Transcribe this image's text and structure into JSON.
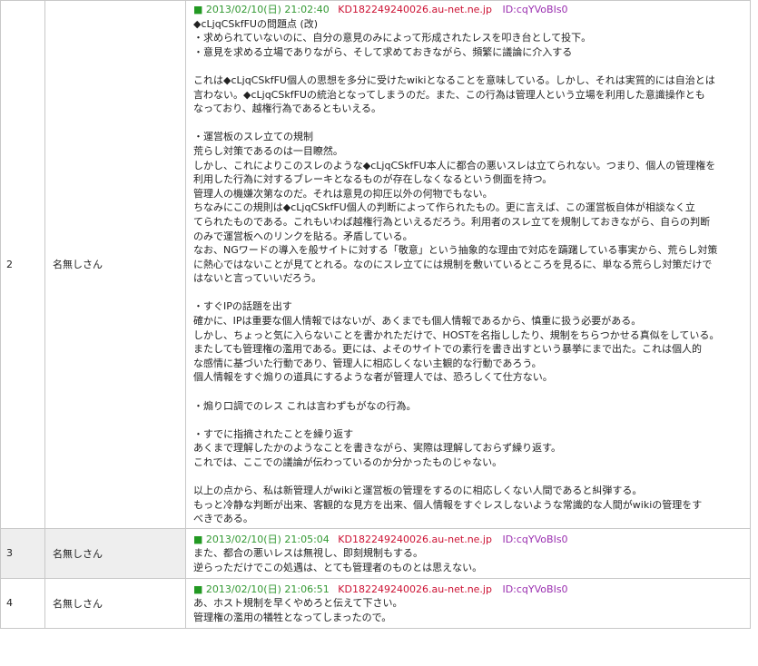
{
  "posts": [
    {
      "number": "2",
      "name": "名無しさん",
      "marker": "■",
      "date": "2013/02/10(日) 21:02:40",
      "host": "KD182249240026.au-net.ne.jp",
      "id": "ID:cqYVoBIs0",
      "lines": [
        "◆cLjqCSkfFUの問題点 (改)",
        "・求められていないのに、自分の意見のみによって形成されたレスを叩き台として投下。",
        "・意見を求める立場でありながら、そして求めておきながら、頻繁に議論に介入する",
        "",
        "これは◆cLjqCSkfFU個人の思想を多分に受けたwikiとなることを意味している。しかし、それは実質的には自治とは",
        "言わない。◆cLjqCSkfFUの統治となってしまうのだ。また、この行為は管理人という立場を利用した意識操作とも",
        "なっており、越権行為であるともいえる。",
        "",
        "・運営板のスレ立ての規制",
        "荒らし対策であるのは一目瞭然。",
        "しかし、これによりこのスレのような◆cLjqCSkfFU本人に都合の悪いスレは立てられない。つまり、個人の管理権を",
        "利用した行為に対するブレーキとなるものが存在しなくなるという側面を持つ。",
        "管理人の機嫌次第なのだ。それは意見の抑圧以外の何物でもない。",
        "ちなみにこの規則は◆cLjqCSkfFU個人の判断によって作られたもの。更に言えば、この運営板自体が相談なく立",
        "てられたものである。これもいわば越権行為といえるだろう。利用者のスレ立てを規制しておきながら、自らの判断",
        "のみで運営板へのリンクを貼る。矛盾している。",
        "なお、NGワードの導入を般サイトに対する「敬意」という抽象的な理由で対応を躊躇している事実から、荒らし対策",
        "に熱心ではないことが見てとれる。なのにスレ立てには規制を敷いているところを見るに、単なる荒らし対策だけで",
        "はないと言っていいだろう。",
        "",
        "・すぐIPの話題を出す",
        "確かに、IPは重要な個人情報ではないが、あくまでも個人情報であるから、慎重に扱う必要がある。",
        "しかし、ちょっと気に入らないことを書かれただけで、HOSTを名指ししたり、規制をちらつかせる真似をしている。",
        "またしても管理権の濫用である。更には、よそのサイトでの素行を書き出すという暴挙にまで出た。これは個人的",
        "な感情に基づいた行動であり、管理人に相応しくない主観的な行動であろう。",
        "個人情報をすぐ煽りの道具にするような者が管理人では、恐ろしくて仕方ない。",
        "",
        "・煽り口調でのレス これは言わずもがなの行為。",
        "",
        "・すでに指摘されたことを繰り返す",
        "あくまで理解したかのようなことを書きながら、実際は理解しておらず繰り返す。",
        "これでは、ここでの議論が伝わっているのか分かったものじゃない。",
        "",
        "以上の点から、私は新管理人がwikiと運営板の管理をするのに相応しくない人間であると糾弾する。",
        "もっと冷静な判断が出来、客観的な見方を出来、個人情報をすぐレスしないような常識的な人間がwikiの管理をす",
        "べきである。"
      ]
    },
    {
      "number": "3",
      "name": "名無しさん",
      "marker": "■",
      "date": "2013/02/10(日) 21:05:04",
      "host": "KD182249240026.au-net.ne.jp",
      "id": "ID:cqYVoBIs0",
      "lines": [
        "また、都合の悪いレスは無視し、即刻規制もする。",
        "逆らっただけでこの処遇は、とても管理者のものとは思えない。"
      ]
    },
    {
      "number": "4",
      "name": "名無しさん",
      "marker": "■",
      "date": "2013/02/10(日) 21:06:51",
      "host": "KD182249240026.au-net.ne.jp",
      "id": "ID:cqYVoBIs0",
      "lines": [
        "あ、ホスト規制を早くやめろと伝えて下さい。",
        "管理権の濫用の犠牲となってしまったので。"
      ]
    }
  ]
}
